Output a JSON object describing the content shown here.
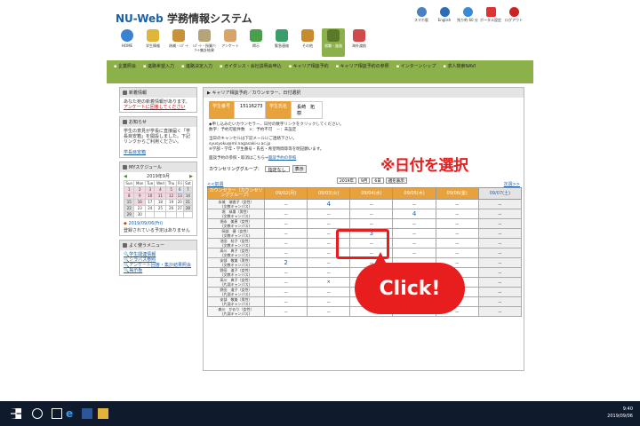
{
  "header": {
    "logo": "NU-Web",
    "title": " 学務情報システム",
    "top_icons": [
      "スマホ版",
      "English",
      "残り約 60 分",
      "ポータル設定",
      "ログアウト"
    ],
    "nav": [
      "HOME",
      "学生情報",
      "休補・ﾚﾎﾟｰﾄ",
      "ﾚﾎﾟｰﾄ・授業ｱﾝｹｰﾄ集計結果",
      "アンケート",
      "掲示",
      "緊急連絡",
      "その他",
      "就職・進路",
      "海外渡航"
    ]
  },
  "greenbar": [
    "企業照会",
    "進路希望入力",
    "進路決定入力",
    "ガイダンス・会社説明会申込",
    "キャリア相談予約",
    "キャリア相談予約の参照",
    "インターンシップ",
    "求人検索NAVI"
  ],
  "sidebar": {
    "new_title": "新着情報",
    "new_text": "あなた宛の新着情報があります。",
    "new_link": "アンケートに回答してください",
    "notice_title": "お知らせ",
    "notice_text": "学生の意見が学長に直接届く「学長目安箱」を開設しました。下記リンクからご利用ください。",
    "notice_link": "学長目安箱",
    "schedule_title": "MYスケジュール",
    "month": "2019年9月",
    "weekdays": [
      "Sun",
      "Mon",
      "Tue",
      "Wed",
      "Thu",
      "Fri",
      "Sat"
    ],
    "week1": [
      "1",
      "2",
      "3",
      "4",
      "5",
      "6",
      "7"
    ],
    "week2": [
      "8",
      "9",
      "10",
      "11",
      "12",
      "13",
      "14"
    ],
    "week3": [
      "15",
      "16",
      "17",
      "18",
      "19",
      "20",
      "21"
    ],
    "week4": [
      "22",
      "23",
      "24",
      "25",
      "26",
      "27",
      "28"
    ],
    "week5": [
      "29",
      "30",
      "",
      "",
      "",
      "",
      ""
    ],
    "date_line": "2019/09/06(Fri)",
    "no_sched": "登録されている予定はありません",
    "menu_title": "よく使うメニュー",
    "menu": [
      "学生関連情報",
      "シラバス参照",
      "アンケート回答・集計結果照会",
      "掲示板"
    ]
  },
  "main": {
    "title": "キャリア相談予約／カウンセラー、日付選択",
    "sid_label": "学生番号",
    "sid": "15116273",
    "name_label": "学生氏名",
    "name": "長崎　拓樹",
    "line1": "◆申し込みたいカウンセラー、日付の数字リンクをクリックしてください。",
    "line2": "数字：予約可能件数　×：予約不可　－：未設定",
    "line3": "当日のキャンセルは下記メールにご連絡下さい。",
    "line4": "syusyoku@ml.nagasaki-u.ac.jp",
    "line5": "※学部・学年・学生番号・氏名・希望時間等等を明記願います。",
    "line6": "面談予約の参照・取消はこちら⇒",
    "line6_link": "面談予約の参照",
    "group_label": "カウンセリンググループ：",
    "group_value": "指定なし",
    "show_btn": "表示",
    "ctrl_year": "2019年",
    "ctrl_month": "9月",
    "ctrl_day": "6日",
    "ctrl_btn": "週を表示",
    "prev": "<<前週",
    "next": "次週>>",
    "head_counselor": "カウンセラー（カウンセリンググループ）",
    "days": [
      "09/02(月)",
      "09/03(火)",
      "09/04(水)",
      "09/05(木)",
      "09/06(金)",
      "09/07(土)"
    ],
    "rows": [
      {
        "name": "永城　瑞香子（女性）",
        "campus": "(文教キャンパス)",
        "v": [
          "－",
          "4",
          "－",
          "－",
          "－",
          "－"
        ]
      },
      {
        "name": "堀　恭惠（男性）",
        "campus": "(文教キャンパス)",
        "v": [
          "－",
          "－",
          "－",
          "4",
          "－",
          "－"
        ]
      },
      {
        "name": "堀永　美恵（女性）",
        "campus": "(文教キャンパス)",
        "v": [
          "－",
          "－",
          "－",
          "－",
          "－",
          "－"
        ]
      },
      {
        "name": "岡部　捷（女性）",
        "campus": "(文教キャンパス)",
        "v": [
          "－",
          "－",
          "3",
          "－",
          "－",
          "－"
        ]
      },
      {
        "name": "池田　桂子（女性）",
        "campus": "(文教キャンパス)",
        "v": [
          "－",
          "－",
          "－",
          "－",
          "－",
          "－"
        ]
      },
      {
        "name": "高川　典子（女性）",
        "campus": "(文教キャンパス)",
        "v": [
          "－",
          "－",
          "－",
          "－",
          "－",
          "－"
        ]
      },
      {
        "name": "安部　敬美（男性）",
        "campus": "(文教キャンパス)",
        "v": [
          "2",
          "－",
          "－",
          "－",
          "－",
          "－"
        ]
      },
      {
        "name": "野田　道子（女性）",
        "campus": "(文教キャンパス)",
        "v": [
          "－",
          "－",
          "－",
          "－",
          "－",
          "－"
        ]
      },
      {
        "name": "高川　典子（女性）",
        "campus": "(片淵キャンパス)",
        "v": [
          "－",
          "×",
          "－",
          "－",
          "－",
          "－"
        ]
      },
      {
        "name": "野田　道子（女性）",
        "campus": "(片淵キャンパス)",
        "v": [
          "－",
          "－",
          "－",
          "－",
          "－",
          "－"
        ]
      },
      {
        "name": "安部　敬美（男性）",
        "campus": "(片淵キャンパス)",
        "v": [
          "－",
          "－",
          "－",
          "－",
          "－",
          "－"
        ]
      },
      {
        "name": "森川　かおり（女性）",
        "campus": "(片淵キャンパス)",
        "v": [
          "－",
          "－",
          "－",
          "1",
          "－",
          "－"
        ]
      }
    ]
  },
  "annotations": {
    "select_date": "※日付を選択",
    "click": "Click!"
  },
  "taskbar": {
    "time": "9:40",
    "date": "2019/09/06"
  },
  "colors": {
    "accent_green": "#8cb14a",
    "header_orange": "#e8a23d",
    "annotation_red": "#e81d1d"
  }
}
